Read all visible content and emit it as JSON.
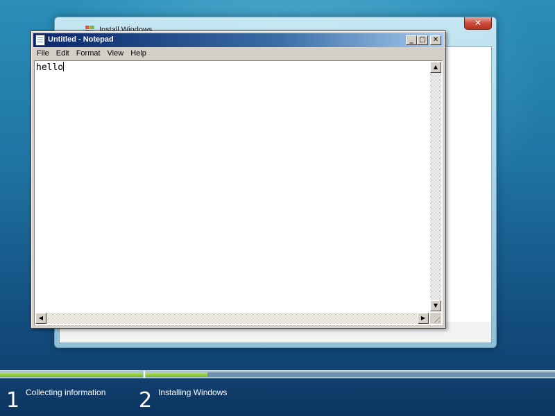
{
  "installer": {
    "title": "Install Windows",
    "close_label": "✕"
  },
  "notepad": {
    "title": "Untitled - Notepad",
    "controls": {
      "minimize": "_",
      "maximize": "□",
      "close": "✕"
    },
    "menu": [
      "File",
      "Edit",
      "Format",
      "View",
      "Help"
    ],
    "text": "hello"
  },
  "progress": {
    "step1_fraction": 1.0,
    "step2_fraction": 0.15,
    "accent_color": "#78b82a"
  },
  "steps": [
    {
      "number": "1",
      "label": "Collecting information"
    },
    {
      "number": "2",
      "label": "Installing Windows"
    }
  ]
}
